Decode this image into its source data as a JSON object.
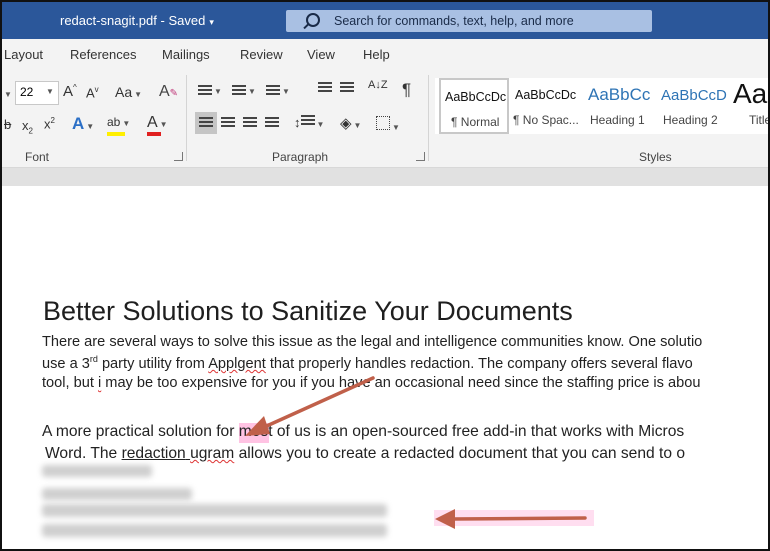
{
  "titlebar": {
    "doc_name": "redact-snagit.pdf",
    "separator": "-",
    "status": "Saved",
    "caret": "▾",
    "search_placeholder": "Search for commands, text, help, and more",
    "color": "#2b579a"
  },
  "tabs": [
    "Layout",
    "References",
    "Mailings",
    "Review",
    "View",
    "Help"
  ],
  "font_group": {
    "size_value": "22",
    "grow_label": "A",
    "shrink_label": "A",
    "case_label": "Aa",
    "clear_label": "A",
    "sub_label": "x",
    "super_label": "x",
    "effects_label": "A",
    "highlight_label": "ab",
    "color_label": "A",
    "group_label": "Font"
  },
  "paragraph_group": {
    "sort_label": "A↓Z",
    "pilcrow": "¶",
    "group_label": "Paragraph"
  },
  "styles": {
    "items": [
      {
        "preview": "AaBbCcDc",
        "name": "¶ Normal"
      },
      {
        "preview": "AaBbCcDc",
        "name": "¶ No Spac..."
      },
      {
        "preview": "AaBbCc",
        "name": "Heading 1"
      },
      {
        "preview": "AaBbCcD",
        "name": "Heading 2"
      },
      {
        "preview": "Aa",
        "name": "Title"
      }
    ],
    "group_label": "Styles"
  },
  "document": {
    "heading": "Better Solutions to Sanitize Your Documents",
    "p1_line1": "There are several ways to solve this issue as the legal and intelligence communities know. One solutio",
    "p1_line2_a": "use a 3",
    "p1_line2_sup": "rd",
    "p1_line2_b": " party utility from ",
    "p1_line2_err": "Applgent",
    "p1_line2_c": " that properly handles redaction. The company offers several flavo",
    "p1_line3_a": "tool, but ",
    "p1_line3_err": "i",
    "p1_line3_b": " may be too expensive for you if you have an occasional need since the staffing price is abou",
    "p2_line1": "A more practical solution for most of us is an open-sourced free add-in that works with Micros",
    "p2_line2_a": "Word. The ",
    "p2_line2_link1": "redaction",
    "p2_line2_sp": " ",
    "p2_line2_link2": "ugram",
    "p2_line2_b": " allows you to create a redacted document that you can send to o"
  },
  "colors": {
    "arrow": "#c0604a",
    "highlight": "#ffaad7",
    "ribbon_bg": "#f3f3f3"
  }
}
